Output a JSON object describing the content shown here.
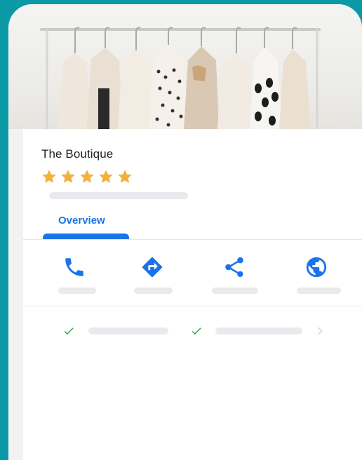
{
  "business": {
    "name": "The Boutique",
    "rating_stars": 5
  },
  "tabs": [
    {
      "label": "Overview",
      "active": true
    }
  ],
  "actions": [
    {
      "name": "call",
      "icon": "phone-icon"
    },
    {
      "name": "directions",
      "icon": "directions-icon"
    },
    {
      "name": "share",
      "icon": "share-icon"
    },
    {
      "name": "website",
      "icon": "globe-icon"
    }
  ],
  "attributes": [
    {
      "icon": "check-icon"
    },
    {
      "icon": "check-icon"
    }
  ],
  "colors": {
    "background": "#0a9aa6",
    "accent": "#1a73e8",
    "star": "#f2b13e",
    "check": "#34a853"
  }
}
